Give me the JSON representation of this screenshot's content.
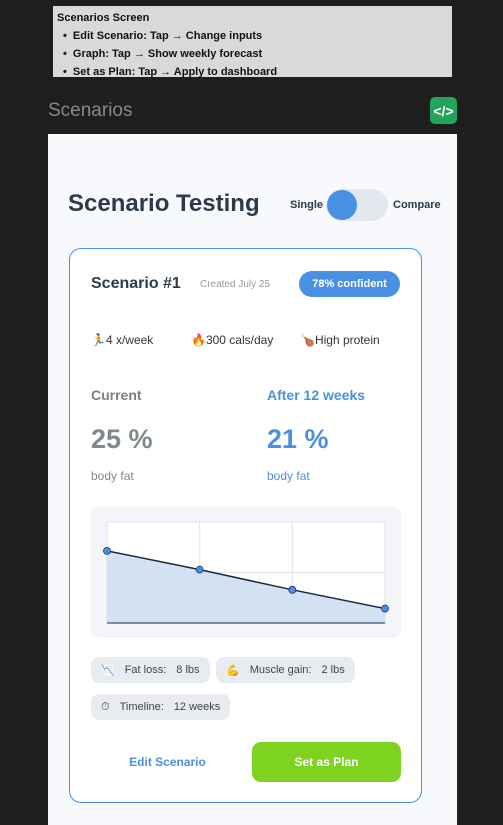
{
  "note": {
    "title": "Scenarios Screen",
    "items": [
      "Edit Scenario: Tap → Change inputs",
      "Graph: Tap → Show weekly forecast",
      "Set as Plan: Tap → Apply to dashboard"
    ]
  },
  "header": {
    "title": "Scenarios",
    "code_icon": "</>"
  },
  "page": {
    "title": "Scenario Testing",
    "toggle_left": "Single",
    "toggle_right": "Compare",
    "toggle_state": "Single"
  },
  "scenario": {
    "name": "Scenario #1",
    "created": "Created July 25",
    "confidence": "78% confident",
    "tags": [
      {
        "icon": "🏃",
        "text": "4 x/week"
      },
      {
        "icon": "🔥",
        "text": "300 cals/day"
      },
      {
        "icon": "🍗",
        "text": "High protein"
      }
    ],
    "current": {
      "label": "Current",
      "value": "25 %",
      "unit": "body fat"
    },
    "after": {
      "label": "After 12 weeks",
      "value": "21 %",
      "unit": "body fat"
    },
    "chips": [
      {
        "icon": "📉",
        "label": "Fat loss:",
        "value": "8 lbs"
      },
      {
        "icon": "💪",
        "label": "Muscle gain:",
        "value": "2 lbs"
      },
      {
        "icon": "⏱",
        "label": "Timeline:",
        "value": "12 weeks"
      }
    ],
    "edit_label": "Edit Scenario",
    "plan_label": "Set as Plan"
  },
  "chart_data": {
    "type": "area",
    "x": [
      0,
      4,
      8,
      12
    ],
    "values": [
      25,
      23.7,
      22.3,
      21
    ],
    "ylim": [
      20,
      27
    ],
    "grid": true,
    "colors": {
      "line": "#1a2a3a",
      "fill": "#d3e2f2",
      "point": "#4a90e2"
    }
  }
}
